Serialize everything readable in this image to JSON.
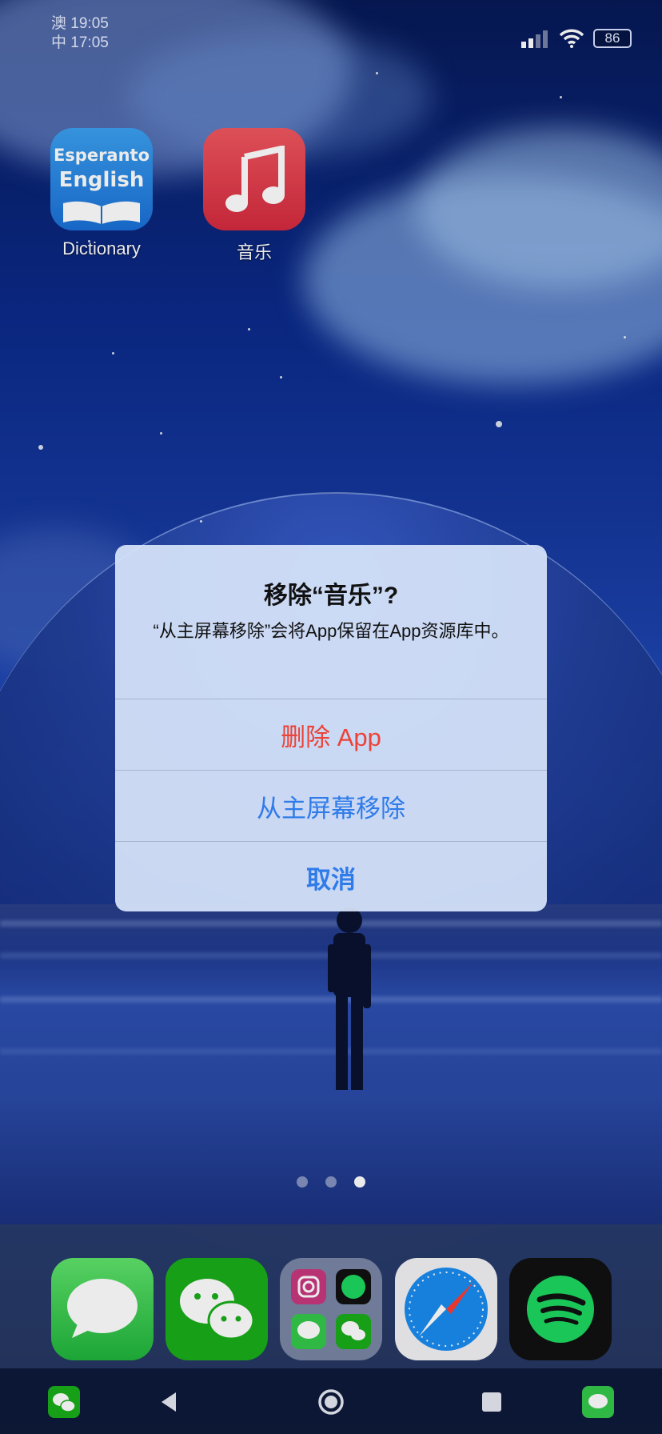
{
  "status_bar": {
    "clock_line1": "澳 19:05",
    "clock_line2": "中 17:05",
    "battery": "86"
  },
  "home_apps": [
    {
      "label": "Dictionary",
      "tile_line1": "Esperanto",
      "tile_line2": "English"
    },
    {
      "label": "音乐"
    }
  ],
  "alert": {
    "title": "移除“音乐”?",
    "message": "“从主屏幕移除”会将App保留在App资源库中。",
    "delete_label": "删除 App",
    "remove_label": "从主屏幕移除",
    "cancel_label": "取消"
  },
  "page_indicator": {
    "count": 3,
    "active_index": 2
  },
  "dock_apps": [
    "messages-icon",
    "wechat-icon",
    "folder-icon",
    "safari-icon",
    "spotify-icon"
  ],
  "colors": {
    "destructive": "#ec4237",
    "action": "#2f7be9",
    "music_red": "#e5394a",
    "spotify_green": "#1ed760",
    "messages_green": "#33c94a",
    "wechat_green": "#1aad19"
  }
}
